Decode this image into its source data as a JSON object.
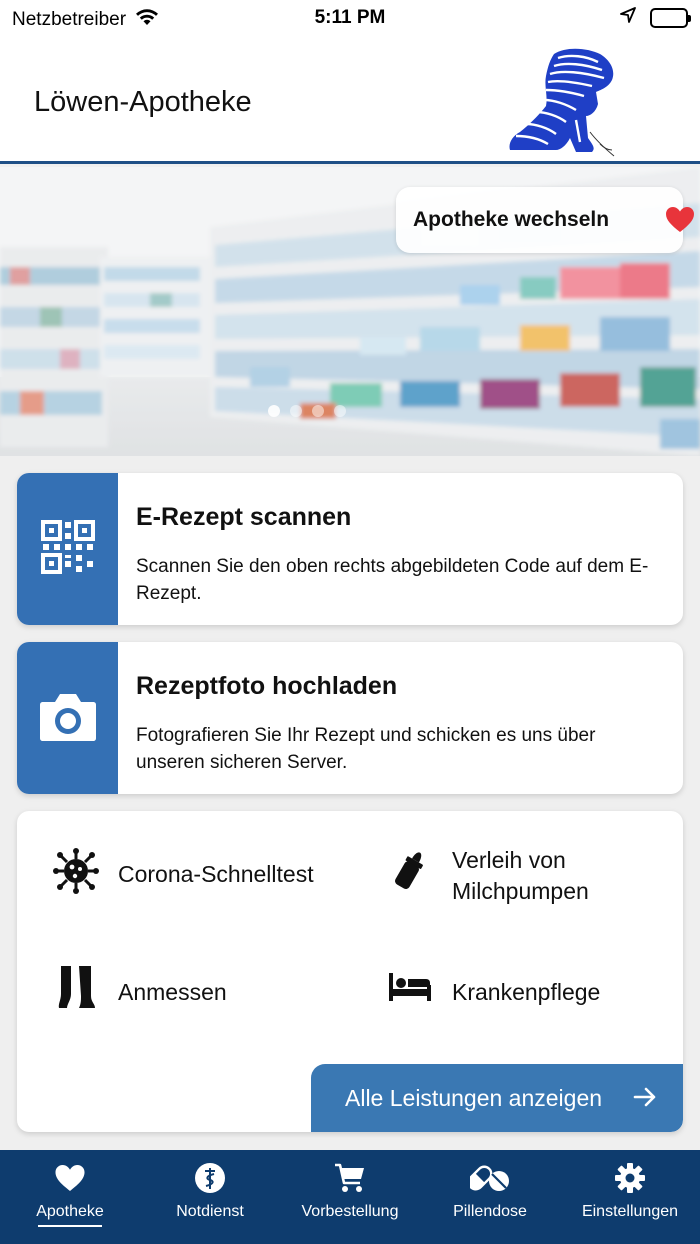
{
  "status_bar": {
    "carrier": "Netzbetreiber",
    "time": "5:11 PM"
  },
  "header": {
    "title": "Löwen-Apotheke",
    "logo_icon": "lion-logo-icon"
  },
  "hero": {
    "change_pharmacy_label": "Apotheke wechseln",
    "heart_color": "#e8343b",
    "carousel_dots": 4,
    "carousel_active_index": 0
  },
  "cards": {
    "erezept": {
      "icon": "qr-code-icon",
      "title": "E-Rezept scannen",
      "text": "Scannen Sie den oben rechts abgebildeten Code auf dem E-Rezept."
    },
    "photo": {
      "icon": "camera-icon",
      "title": "Rezeptfoto hochladen",
      "text": "Fotografieren Sie Ihr Rezept und schicken es uns über unseren sicheren Server."
    }
  },
  "services": {
    "items": [
      {
        "icon": "virus-icon",
        "label": "Corona-Schnelltest"
      },
      {
        "icon": "baby-bottle-icon",
        "label": "Verleih von Milchpumpen"
      },
      {
        "icon": "stockings-icon",
        "label": "Anmessen"
      },
      {
        "icon": "bed-icon",
        "label": "Krankenpflege"
      }
    ],
    "all_button_label": "Alle Leistungen anzeigen"
  },
  "bottom_nav": {
    "items": [
      {
        "icon": "heart-icon",
        "label": "Apotheke",
        "active": true
      },
      {
        "icon": "caduceus-icon",
        "label": "Notdienst",
        "active": false
      },
      {
        "icon": "cart-icon",
        "label": "Vorbestellung",
        "active": false
      },
      {
        "icon": "pills-icon",
        "label": "Pillendose",
        "active": false
      },
      {
        "icon": "gear-icon",
        "label": "Einstellungen",
        "active": false
      }
    ]
  },
  "colors": {
    "accent_blue": "#3470b4",
    "nav_blue": "#0e3c6e",
    "header_line": "#1e4f86"
  }
}
